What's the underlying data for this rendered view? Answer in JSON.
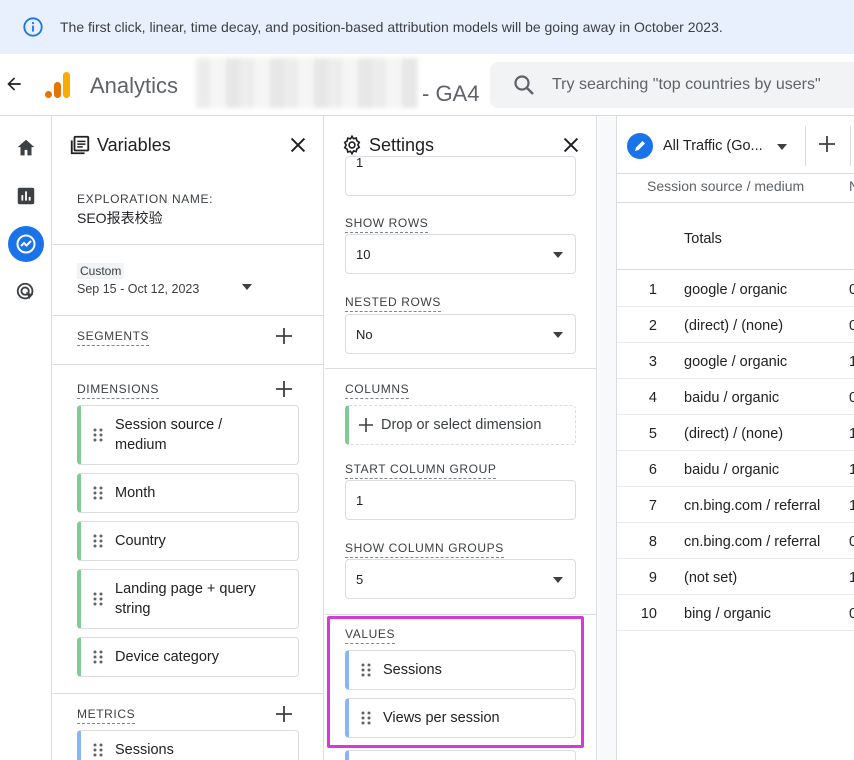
{
  "banner": {
    "text": "The first click, linear, time decay, and position-based attribution models will be going away in October 2023."
  },
  "header": {
    "app_title": "Analytics",
    "property": "- GA4",
    "search_placeholder": "Try searching \"top countries by users\""
  },
  "variables": {
    "title": "Variables",
    "exploration_label": "EXPLORATION NAME:",
    "exploration_name": "SEO报表校验",
    "date_badge": "Custom",
    "date_range": "Sep 15 - Oct 12, 2023",
    "segments_label": "SEGMENTS",
    "dimensions_label": "DIMENSIONS",
    "dimensions": [
      {
        "label": "Session source / medium"
      },
      {
        "label": "Month"
      },
      {
        "label": "Country"
      },
      {
        "label": "Landing page + query string"
      },
      {
        "label": "Device category"
      }
    ],
    "metrics_label": "METRICS",
    "metrics": [
      {
        "label": "Sessions"
      }
    ]
  },
  "settings": {
    "title": "Settings",
    "top_field_value": "1",
    "show_rows_label": "SHOW ROWS",
    "show_rows_value": "10",
    "nested_rows_label": "NESTED ROWS",
    "nested_rows_value": "No",
    "columns_label": "COLUMNS",
    "drop_dimension": "Drop or select dimension",
    "start_col_group_label": "START COLUMN GROUP",
    "start_col_group_value": "1",
    "show_col_groups_label": "SHOW COLUMN GROUPS",
    "show_col_groups_value": "5",
    "values_label": "VALUES",
    "values": [
      {
        "label": "Sessions"
      },
      {
        "label": "Views per session"
      }
    ]
  },
  "table": {
    "tab_label": "All Traffic (Go...",
    "column_header": "Session source / medium",
    "column_header_cut": "N",
    "totals_label": "Totals",
    "rows": [
      {
        "num": "1",
        "value": "google / organic",
        "cut": "0"
      },
      {
        "num": "2",
        "value": "(direct) / (none)",
        "cut": "0"
      },
      {
        "num": "3",
        "value": "google / organic",
        "cut": "1"
      },
      {
        "num": "4",
        "value": "baidu / organic",
        "cut": "0"
      },
      {
        "num": "5",
        "value": "(direct) / (none)",
        "cut": "1"
      },
      {
        "num": "6",
        "value": "baidu / organic",
        "cut": "1"
      },
      {
        "num": "7",
        "value": "cn.bing.com / referral",
        "cut": "1"
      },
      {
        "num": "8",
        "value": "cn.bing.com / referral",
        "cut": "0"
      },
      {
        "num": "9",
        "value": "(not set)",
        "cut": "1"
      },
      {
        "num": "10",
        "value": "bing / organic",
        "cut": "0"
      }
    ]
  },
  "colors": {
    "accent": "#1a73e8",
    "dimension_bar": "#81c995",
    "metric_bar": "#8ab4f8",
    "highlight": "#d63ad6",
    "banner_bg": "#e8f0fe"
  }
}
